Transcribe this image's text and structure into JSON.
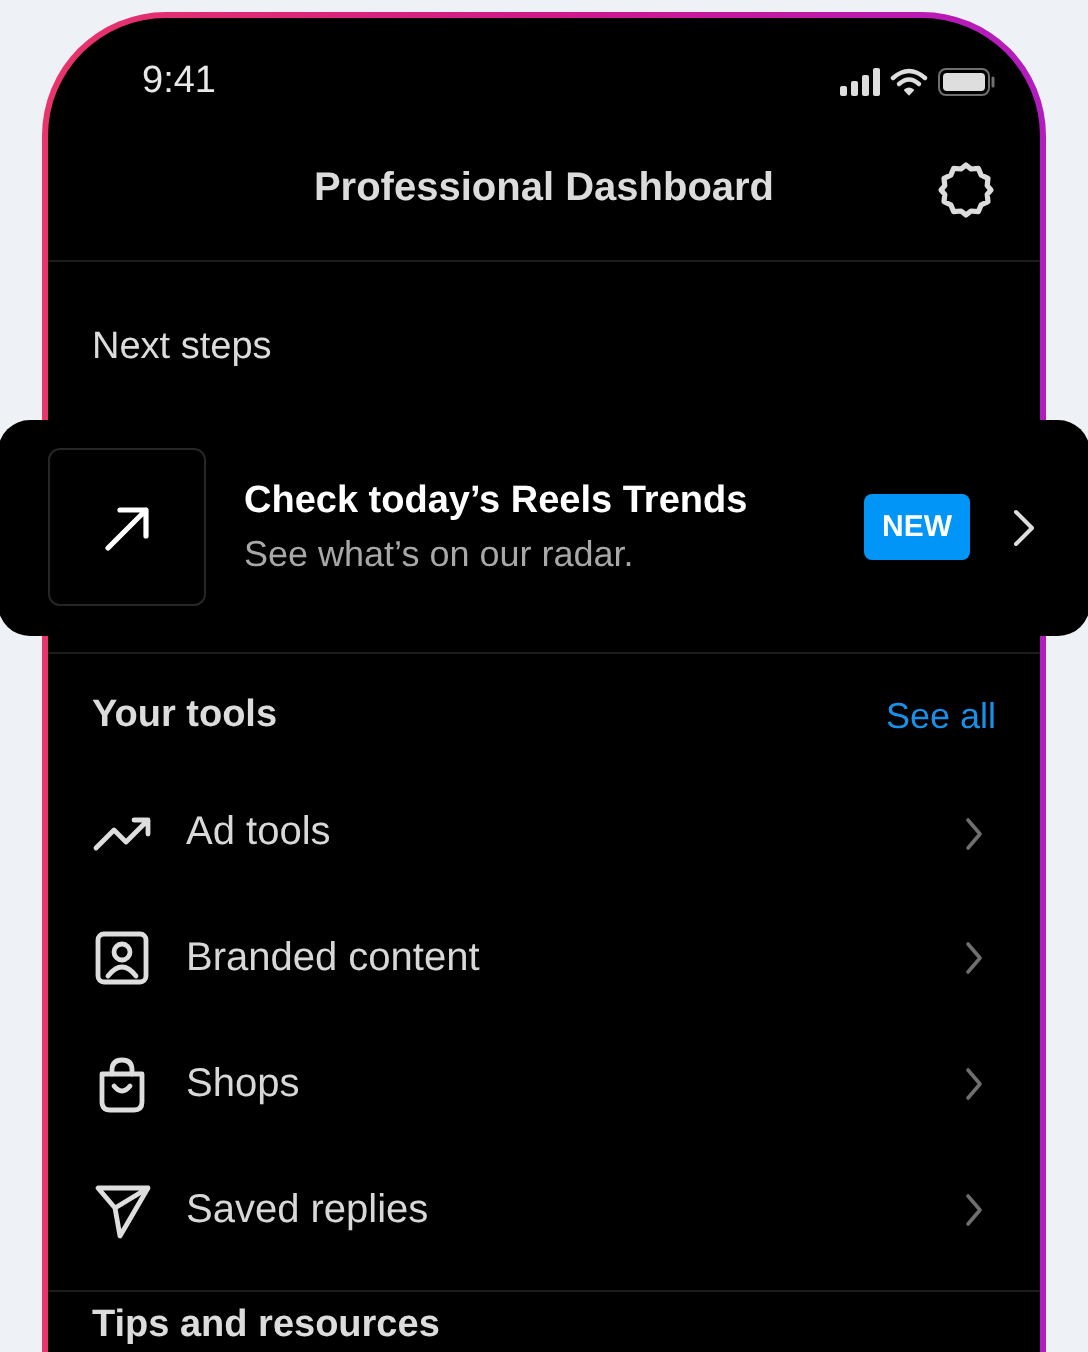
{
  "status_bar": {
    "time": "9:41"
  },
  "header": {
    "title": "Professional Dashboard"
  },
  "next_steps": {
    "heading": "Next steps",
    "card": {
      "title": "Check today’s Reels Trends",
      "subtitle": "See what’s on our radar.",
      "badge": "NEW"
    }
  },
  "tools": {
    "heading": "Your tools",
    "link": "See all",
    "items": [
      {
        "kind": "trend",
        "label": "Ad tools"
      },
      {
        "kind": "portrait",
        "label": "Branded content"
      },
      {
        "kind": "bag",
        "label": "Shops"
      },
      {
        "kind": "plane",
        "label": "Saved replies"
      }
    ]
  },
  "tips": {
    "heading": "Tips and resources"
  }
}
